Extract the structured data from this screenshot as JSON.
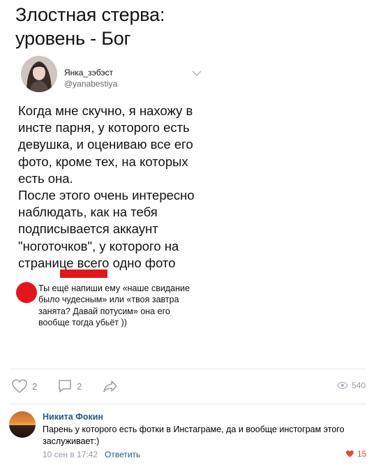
{
  "meme": {
    "title": "Злостная стерва:\nуровень - Бог"
  },
  "tweet": {
    "display_name": "Янка_зэбэст",
    "handle": "@yanabestiya",
    "text": "Когда мне скучно, я нахожу в\nинсте парня, у которого есть\nдевушка, и оцениваю все его\nфото, кроме тех, на которых\nесть она.\nПосле этого очень интересно\nнаблюдать, как на тебя\nподписывается аккаунт\n\"ноготочков\", у которого на\nстранице всего одно фото"
  },
  "reply_bubble": {
    "text": "Ты ещё напиши ему «наше свидание\n было чудесным» или «твоя завтра\nзанята? Давай потусим» она его\nвообще тогда убьёт ))"
  },
  "actions": {
    "likes": "2",
    "comments": "2",
    "views": "540"
  },
  "comment": {
    "author": "Никита Фокин",
    "text": "Парень у которого есть фотки в Инстаграме, да и вообще инстограм этого заслуживает:)",
    "time": "10 сен в 17:42",
    "reply_label": "Ответить",
    "likes": "15"
  },
  "colors": {
    "redaction": "#e3161c",
    "link": "#2a5885",
    "muted": "#828a99",
    "like_active": "#e64646"
  }
}
